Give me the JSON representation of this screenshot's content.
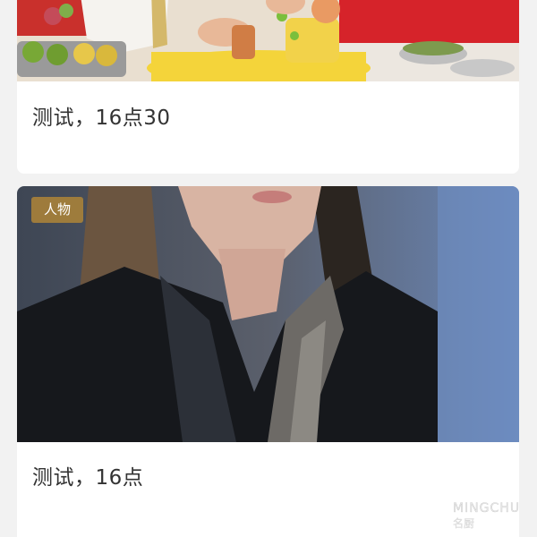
{
  "feed": {
    "cards": [
      {
        "title": "测试，16点30",
        "image_desc": "cooking-scene-image"
      },
      {
        "title": "测试，16点",
        "tag": "人物",
        "image_desc": "person-portrait-image"
      }
    ]
  },
  "watermark": {
    "brand": "MINGCHU",
    "brand_cn": "名厨"
  },
  "colors": {
    "page_bg": "#f2f2f2",
    "card_bg": "#ffffff",
    "title_text": "#333333",
    "tag_bg": "#a6803a"
  }
}
